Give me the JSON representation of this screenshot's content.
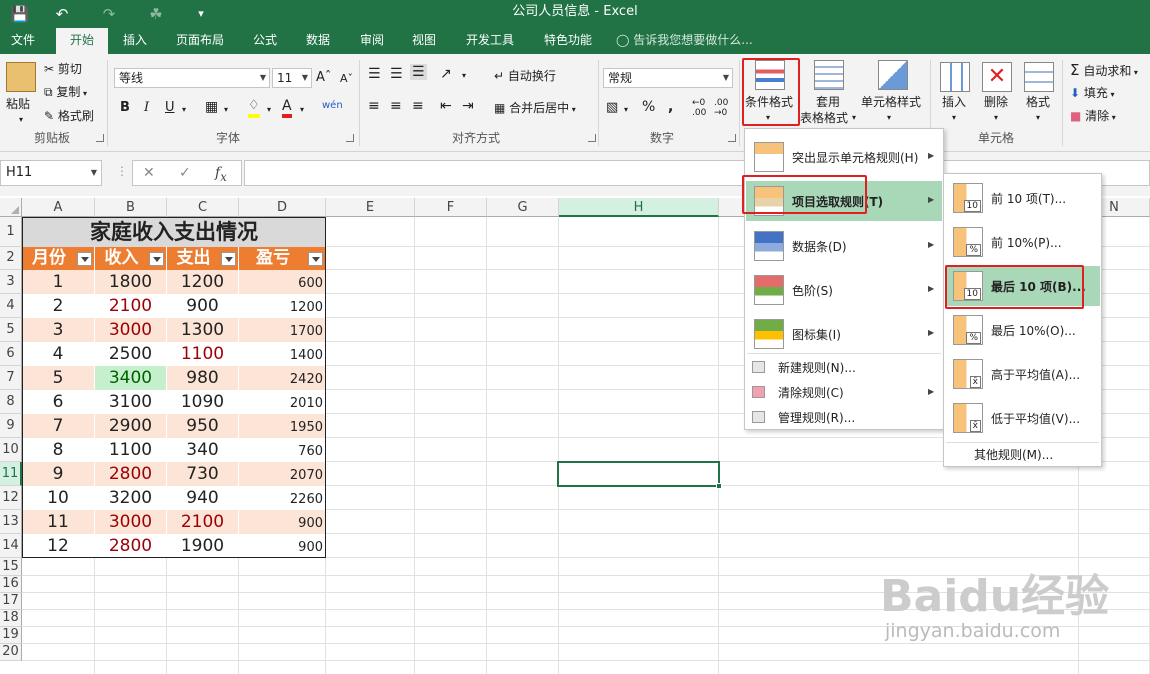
{
  "window": {
    "title": "公司人员信息 - Excel"
  },
  "tabs": [
    "文件",
    "开始",
    "插入",
    "页面布局",
    "公式",
    "数据",
    "审阅",
    "视图",
    "开发工具",
    "特色功能"
  ],
  "tell_me": "告诉我您想要做什么...",
  "ribbon": {
    "clipboard": {
      "paste": "粘贴",
      "cut": "剪切",
      "copy": "复制",
      "format_painter": "格式刷",
      "label": "剪贴板"
    },
    "font": {
      "name": "等线",
      "size": "11",
      "label": "字体"
    },
    "alignment": {
      "wrap": "自动换行",
      "merge": "合并后居中",
      "label": "对齐方式"
    },
    "number": {
      "format": "常规",
      "label": "数字"
    },
    "styles": {
      "conditional": "条件格式",
      "table1": "套用",
      "table2": "表格格式",
      "cell_styles": "单元格样式"
    },
    "cells": {
      "insert": "插入",
      "delete": "删除",
      "format": "格式",
      "label": "单元格"
    },
    "editing": {
      "autosum": "自动求和",
      "fill": "填充",
      "clear": "清除"
    }
  },
  "name_box": "H11",
  "columns": [
    "A",
    "B",
    "C",
    "D",
    "E",
    "F",
    "G",
    "H",
    "N"
  ],
  "rows": [
    "1",
    "2",
    "3",
    "4",
    "5",
    "6",
    "7",
    "8",
    "9",
    "10",
    "11",
    "12",
    "13",
    "14",
    "15",
    "16",
    "17",
    "18",
    "19",
    "20"
  ],
  "table": {
    "title": "家庭收入支出情况",
    "headers": [
      "月份",
      "收入",
      "支出",
      "盈亏"
    ],
    "data": [
      [
        "1",
        "1800",
        "1200",
        "600"
      ],
      [
        "2",
        "2100",
        "900",
        "1200"
      ],
      [
        "3",
        "3000",
        "1300",
        "1700"
      ],
      [
        "4",
        "2500",
        "1100",
        "1400"
      ],
      [
        "5",
        "3400",
        "980",
        "2420"
      ],
      [
        "6",
        "3100",
        "1090",
        "2010"
      ],
      [
        "7",
        "2900",
        "950",
        "1950"
      ],
      [
        "8",
        "1100",
        "340",
        "760"
      ],
      [
        "9",
        "2800",
        "730",
        "2070"
      ],
      [
        "10",
        "3200",
        "940",
        "2260"
      ],
      [
        "11",
        "3000",
        "2100",
        "900"
      ],
      [
        "12",
        "2800",
        "1900",
        "900"
      ]
    ]
  },
  "menu": {
    "items": [
      {
        "label": "突出显示单元格规则(H)"
      },
      {
        "label": "项目选取规则(T)"
      },
      {
        "label": "数据条(D)"
      },
      {
        "label": "色阶(S)"
      },
      {
        "label": "图标集(I)"
      },
      {
        "label": "新建规则(N)..."
      },
      {
        "label": "清除规则(C)"
      },
      {
        "label": "管理规则(R)..."
      }
    ]
  },
  "submenu": {
    "items": [
      {
        "label": "前 10 项(T)...",
        "icon_text": "10"
      },
      {
        "label": "前 10%(P)...",
        "icon_text": "%"
      },
      {
        "label": "最后 10 项(B)...",
        "icon_text": "10"
      },
      {
        "label": "最后 10%(O)...",
        "icon_text": "%"
      },
      {
        "label": "高于平均值(A)...",
        "icon_text": "x̄"
      },
      {
        "label": "低于平均值(V)...",
        "icon_text": "x̄"
      }
    ],
    "other": "其他规则(M)..."
  },
  "watermark": {
    "brand": "Baidu经验",
    "url": "jingyan.baidu.com"
  },
  "colors": {
    "excel_green": "#217346",
    "header_orange": "#ed7d31",
    "band_peach": "#fce4d6",
    "highlight_red": "#9c0006",
    "green_fill": "#c6efce",
    "green_text": "#006100"
  }
}
